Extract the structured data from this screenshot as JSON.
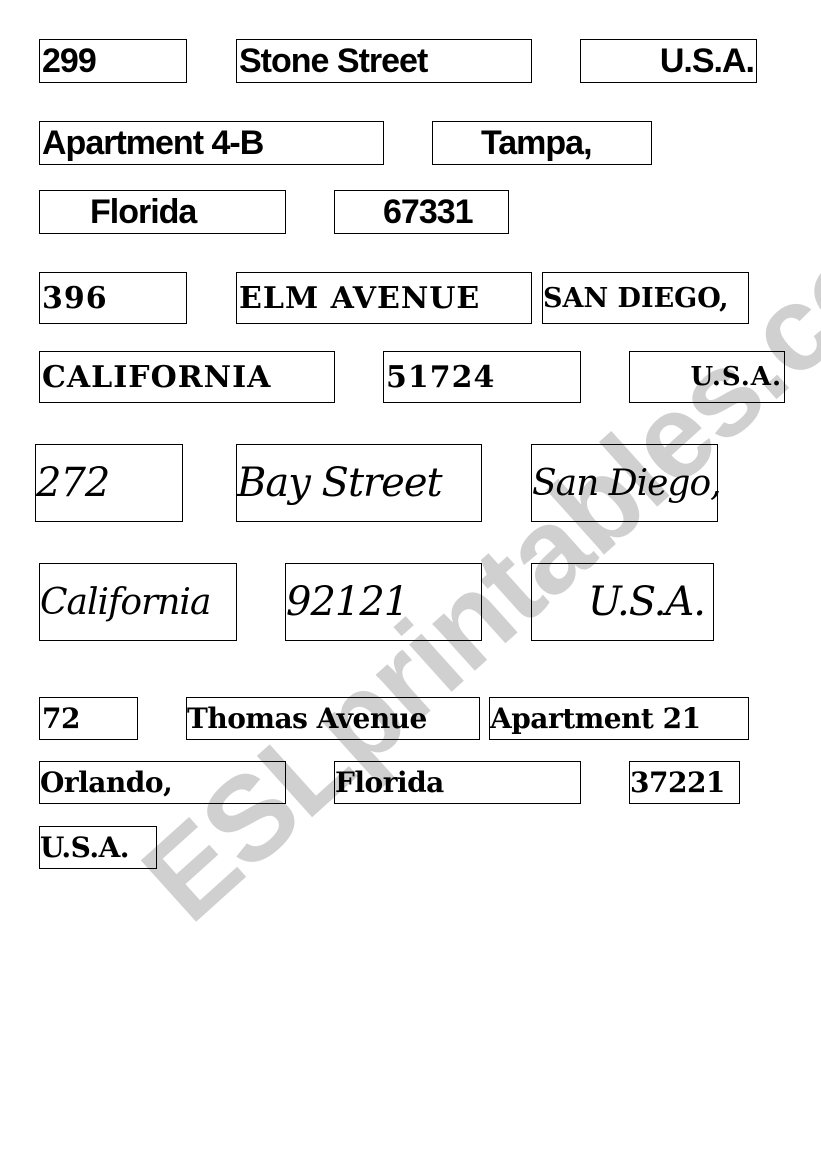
{
  "watermark": "ESLprintables.com",
  "set1": {
    "number": "299",
    "street": "Stone Street",
    "country": "U.S.A.",
    "apartment": "Apartment 4-B",
    "city": "Tampa,",
    "state": "Florida",
    "zip": "67331"
  },
  "set2": {
    "number": "396",
    "street": "ELM AVENUE",
    "city": "SAN DIEGO,",
    "state": "CALIFORNIA",
    "zip": "51724",
    "country": "U.S.A."
  },
  "set3": {
    "number": "272",
    "street": "Bay Street",
    "city": "San Diego,",
    "state": "California",
    "zip": "92121",
    "country": "U.S.A."
  },
  "set4": {
    "number": "72",
    "street": "Thomas Avenue",
    "apartment": "Apartment 21",
    "city": "Orlando,",
    "state": "Florida",
    "zip": "37221",
    "country": "U.S.A."
  }
}
